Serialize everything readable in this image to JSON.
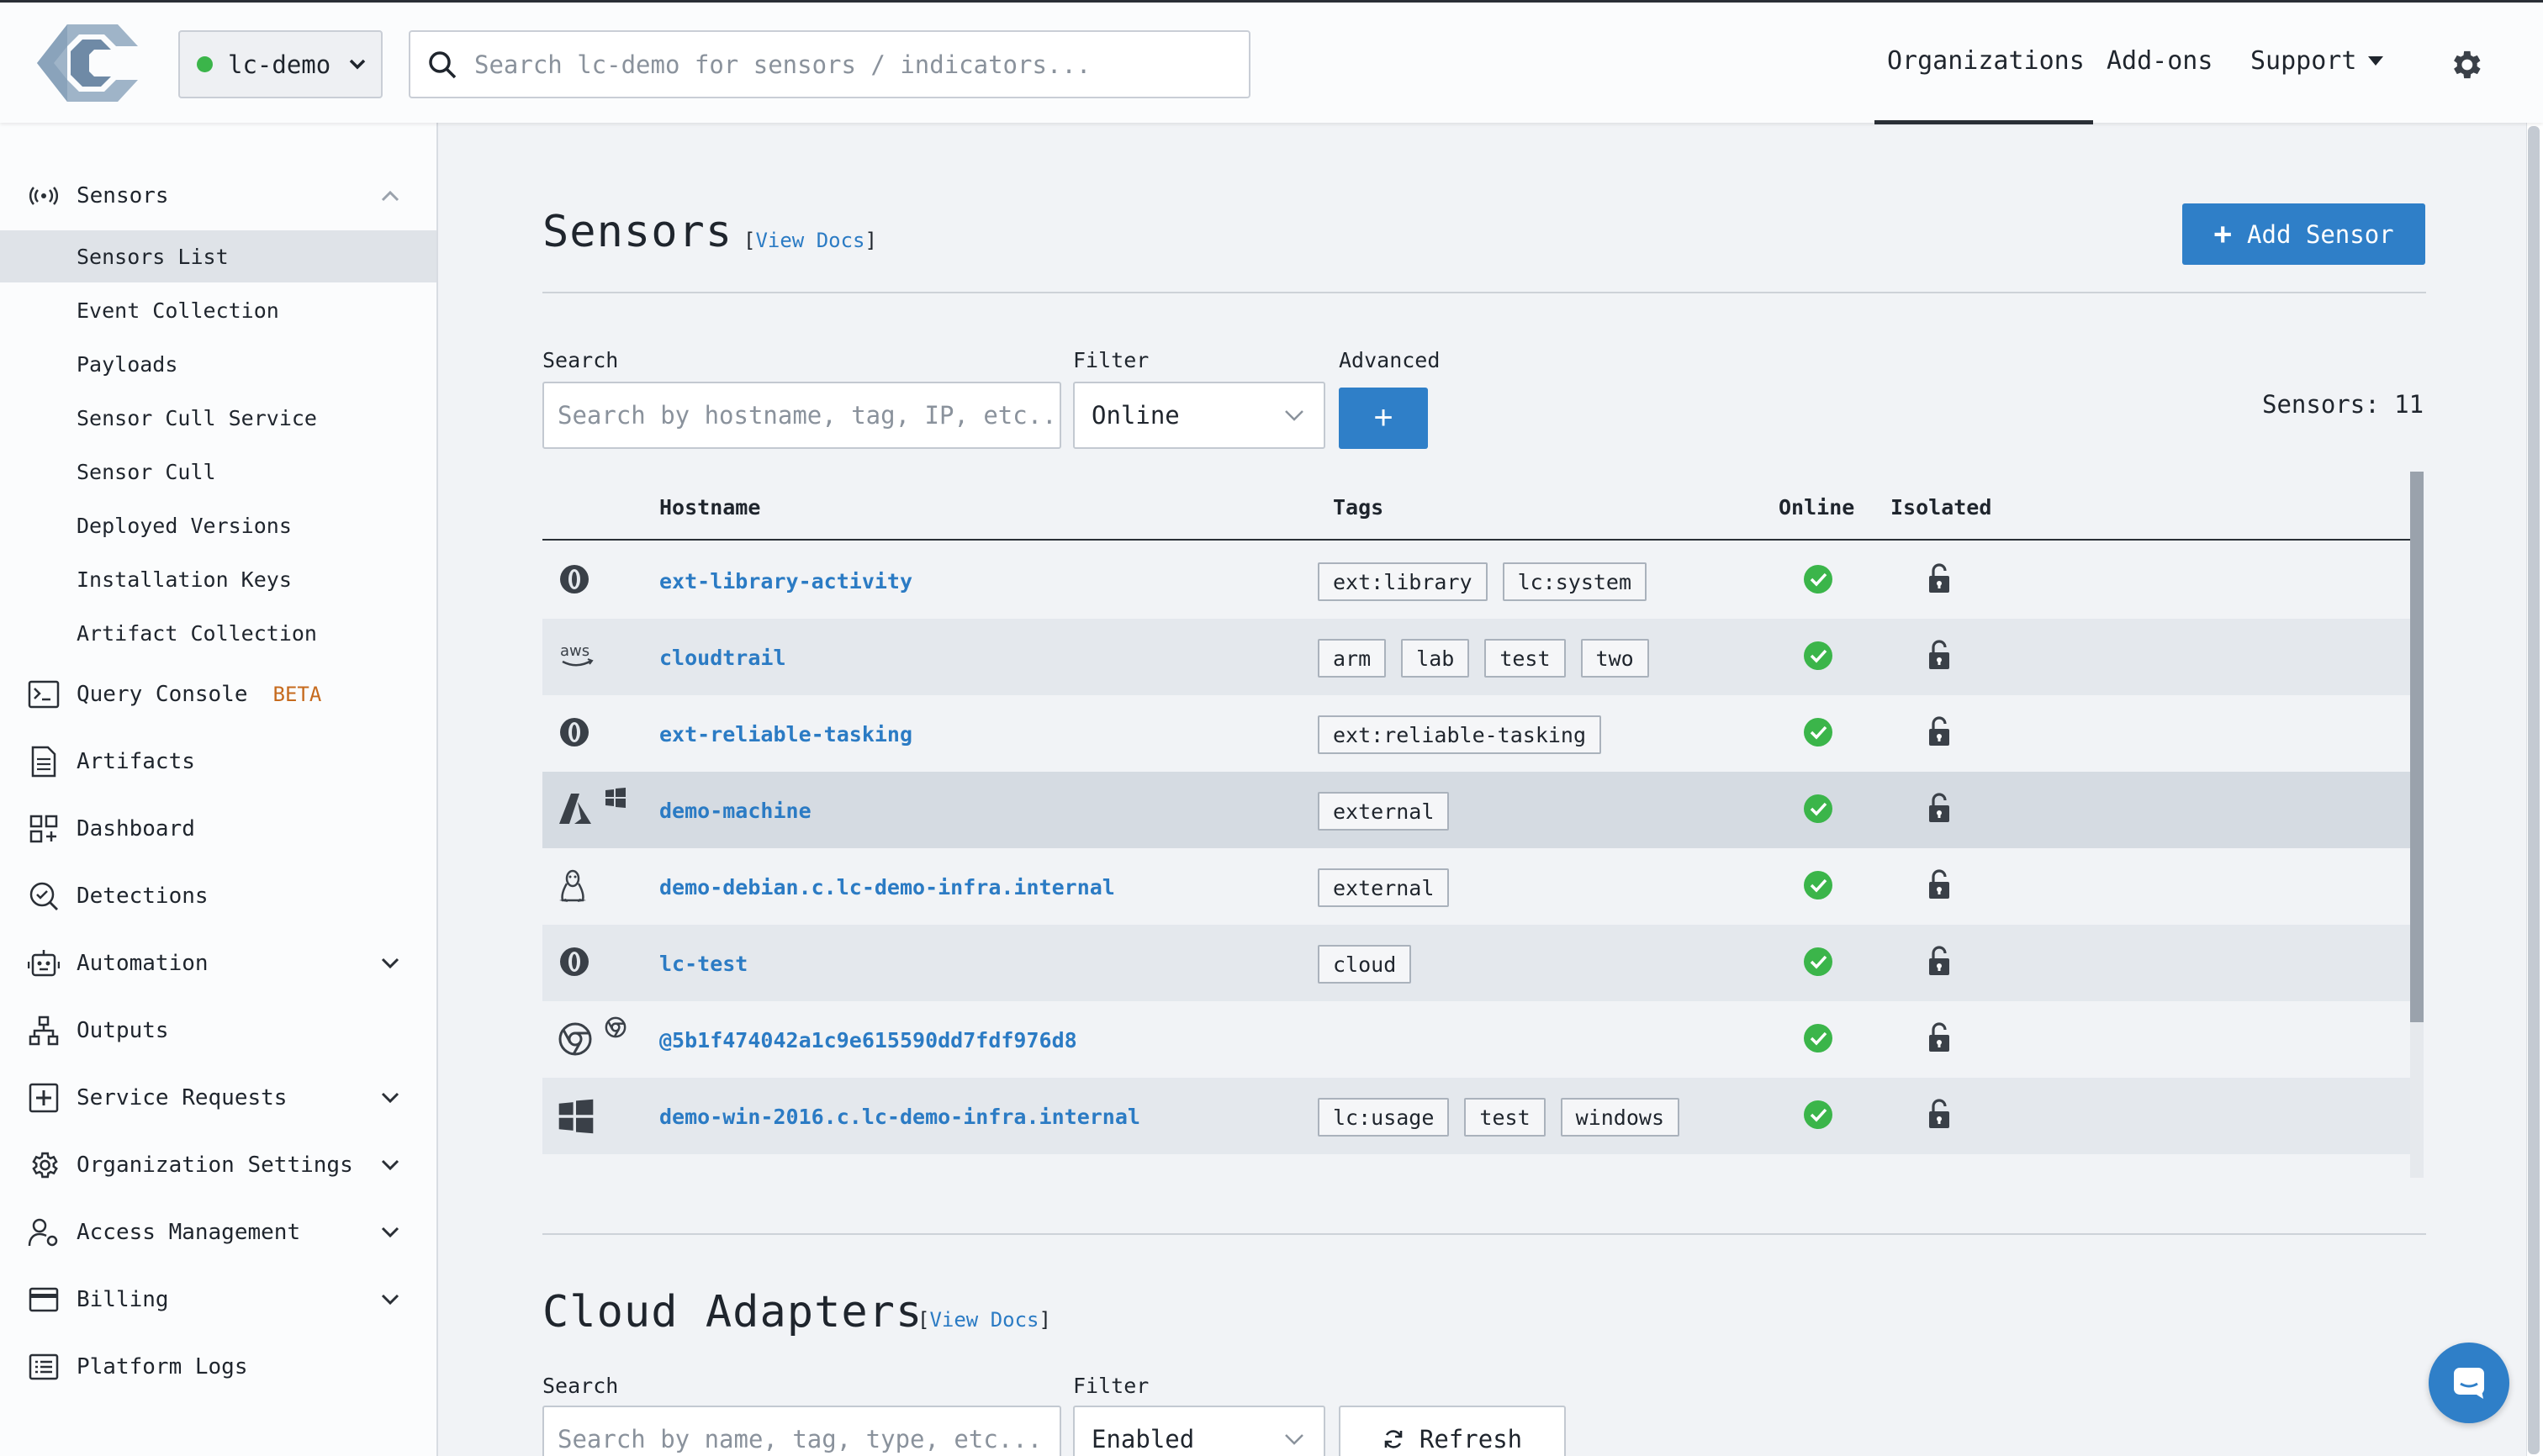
{
  "topbar": {
    "org": "lc-demo",
    "search_placeholder": "Search lc-demo for sensors / indicators...",
    "nav": {
      "organizations": "Organizations",
      "addons": "Add-ons",
      "support": "Support"
    }
  },
  "sidebar": {
    "sensors": "Sensors",
    "sub": [
      "Sensors List",
      "Event Collection",
      "Payloads",
      "Sensor Cull Service",
      "Sensor Cull",
      "Deployed Versions",
      "Installation Keys",
      "Artifact Collection"
    ],
    "query_console": "Query Console",
    "beta": "BETA",
    "artifacts": "Artifacts",
    "dashboard": "Dashboard",
    "detections": "Detections",
    "automation": "Automation",
    "outputs": "Outputs",
    "service_requests": "Service Requests",
    "org_settings": "Organization Settings",
    "access_mgmt": "Access Management",
    "billing": "Billing",
    "platform_logs": "Platform Logs"
  },
  "sensors": {
    "title": "Sensors",
    "docs_open": "[",
    "docs_label": "View Docs",
    "docs_close": "]",
    "add_button": "Add Sensor",
    "search_label": "Search",
    "search_placeholder": "Search by hostname, tag, IP, etc...",
    "filter_label": "Filter",
    "filter_value": "Online",
    "advanced_label": "Advanced",
    "count": "Sensors: 11",
    "columns": {
      "hostname": "Hostname",
      "tags": "Tags",
      "online": "Online",
      "isolated": "Isolated"
    },
    "rows": [
      {
        "os": [
          "ext-icon"
        ],
        "host": "ext-library-activity",
        "tags": [
          "ext:library",
          "lc:system"
        ]
      },
      {
        "os": [
          "aws-icon"
        ],
        "host": "cloudtrail",
        "tags": [
          "arm",
          "lab",
          "test",
          "two"
        ]
      },
      {
        "os": [
          "ext-icon"
        ],
        "host": "ext-reliable-tasking",
        "tags": [
          "ext:reliable-tasking"
        ]
      },
      {
        "os": [
          "azure-icon",
          "windows-small-icon"
        ],
        "host": "demo-machine",
        "tags": [
          "external"
        ]
      },
      {
        "os": [
          "linux-icon"
        ],
        "host": "demo-debian.c.lc-demo-infra.internal",
        "tags": [
          "external"
        ]
      },
      {
        "os": [
          "ext-icon"
        ],
        "host": "lc-test",
        "tags": [
          "cloud"
        ]
      },
      {
        "os": [
          "chrome-icon",
          "chrome-small-icon"
        ],
        "host": "@5b1f474042a1c9e615590dd7fdf976d8",
        "tags": []
      },
      {
        "os": [
          "windows-icon"
        ],
        "host": "demo-win-2016.c.lc-demo-infra.internal",
        "tags": [
          "lc:usage",
          "test",
          "windows"
        ]
      }
    ]
  },
  "cloud_adapters": {
    "title": "Cloud Adapters",
    "docs_label": "View Docs",
    "search_label": "Search",
    "search_placeholder": "Search by name, tag, type, etc...",
    "filter_label": "Filter",
    "filter_value": "Enabled",
    "refresh": "Refresh"
  },
  "colors": {
    "accent": "#2f7fc8",
    "online": "#3bb54a",
    "link": "#2b7bc4",
    "beta": "#c66a1d"
  }
}
